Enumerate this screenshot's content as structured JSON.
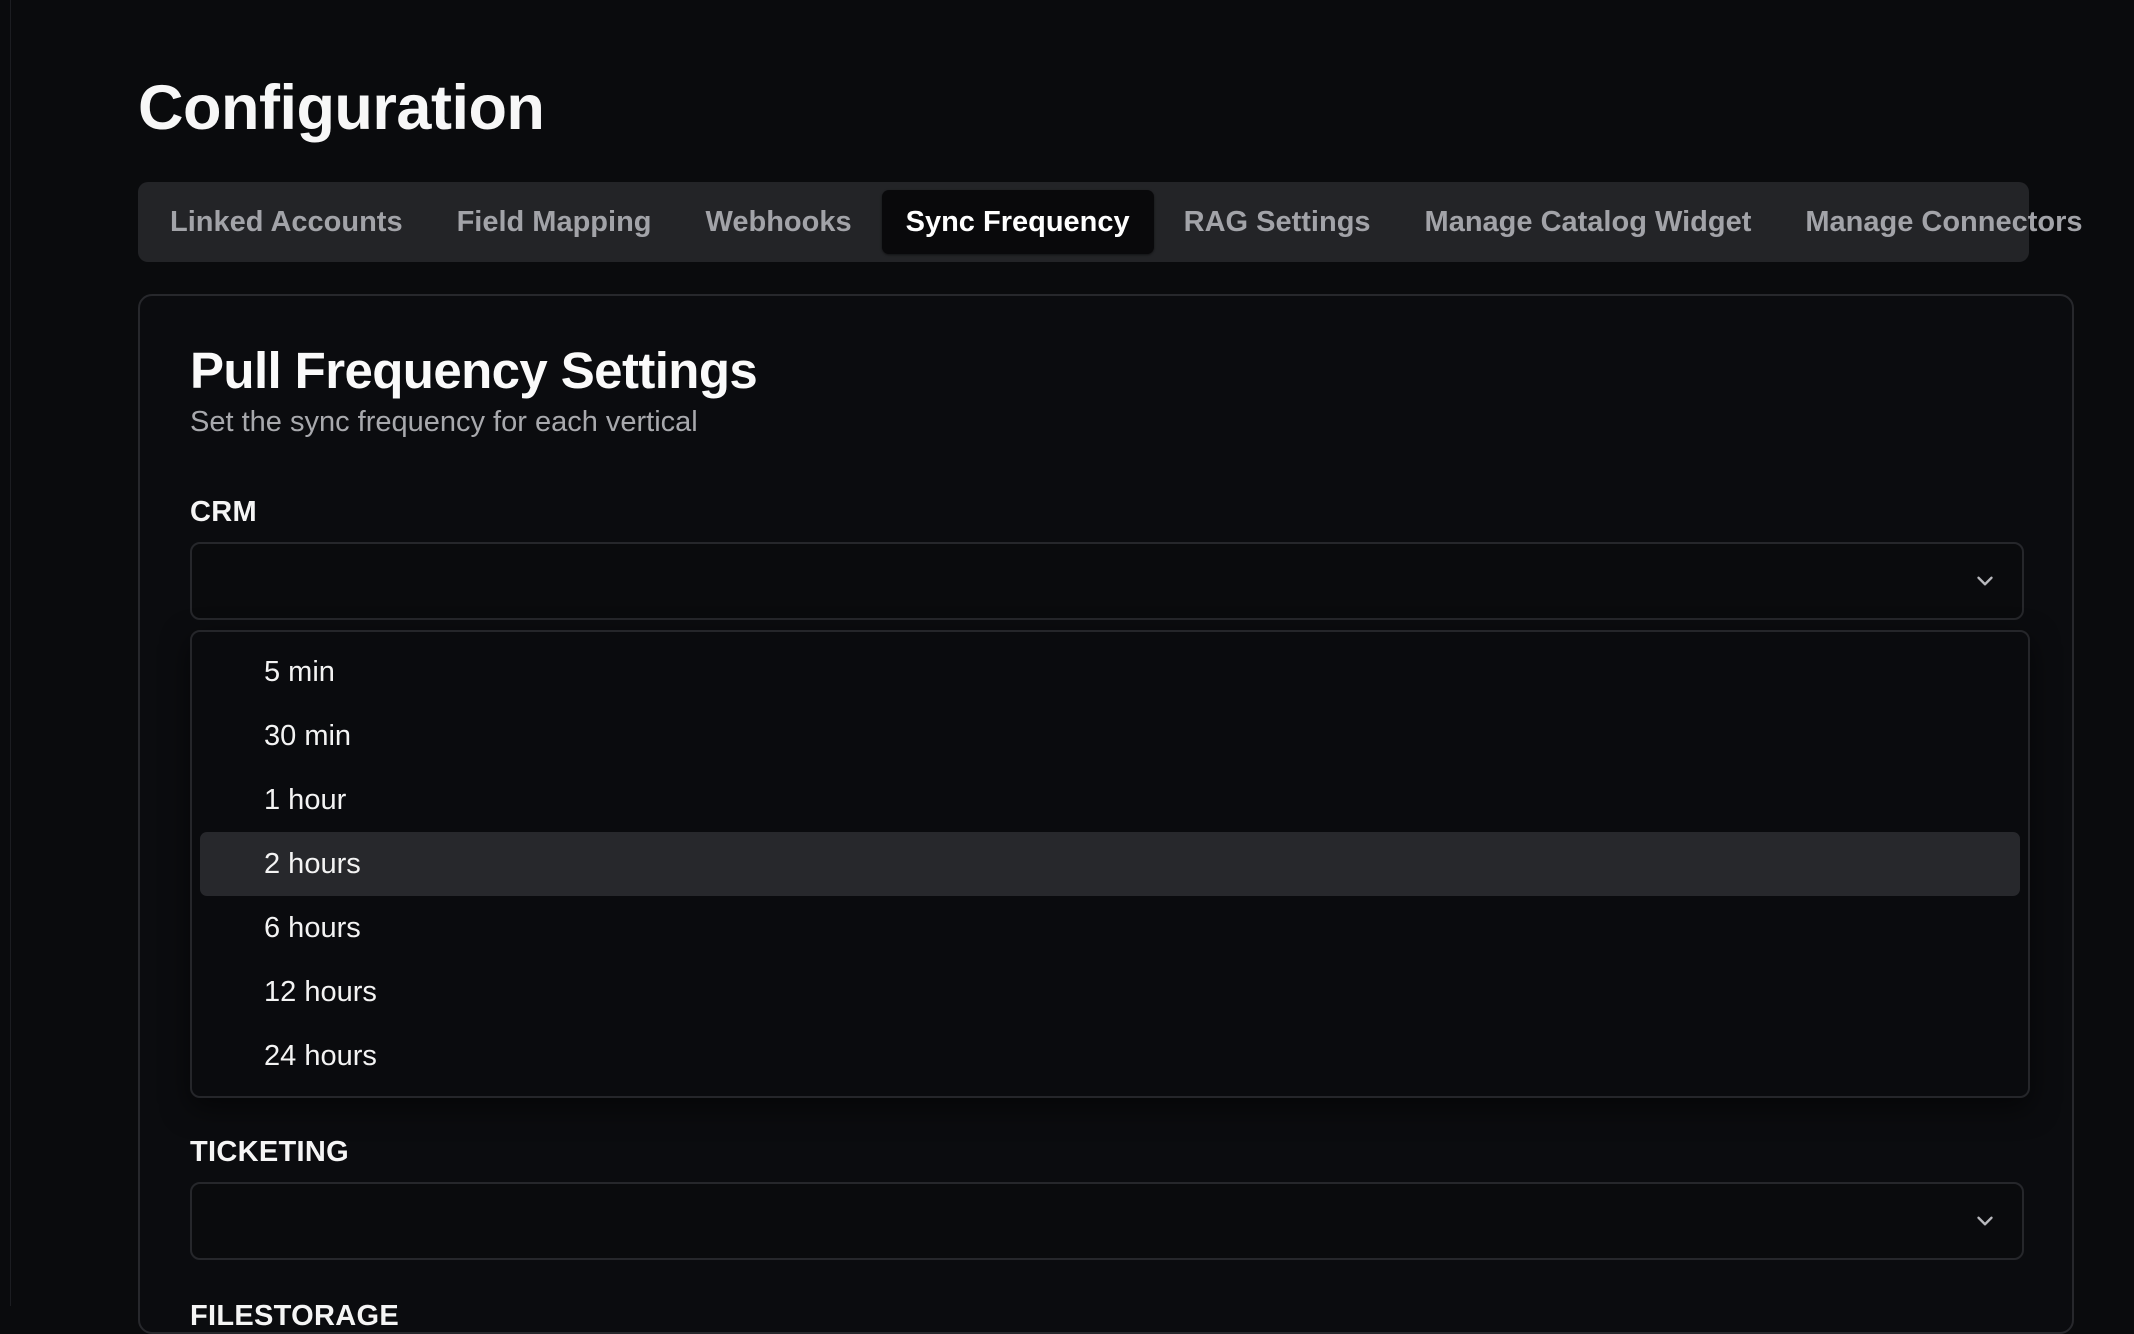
{
  "page": {
    "title": "Configuration"
  },
  "tabs": [
    {
      "label": "Linked Accounts",
      "active": false
    },
    {
      "label": "Field Mapping",
      "active": false
    },
    {
      "label": "Webhooks",
      "active": false
    },
    {
      "label": "Sync Frequency",
      "active": true
    },
    {
      "label": "RAG Settings",
      "active": false
    },
    {
      "label": "Manage Catalog Widget",
      "active": false
    },
    {
      "label": "Manage Connectors",
      "active": false
    }
  ],
  "card": {
    "title": "Pull Frequency Settings",
    "subtitle": "Set the sync frequency for each vertical"
  },
  "verticals": {
    "crm": {
      "label": "CRM",
      "selected_value": "",
      "dropdown_open": true,
      "highlighted_option": "2 hours",
      "chevron_icon": "chevron-down-icon"
    },
    "ticketing": {
      "label": "TICKETING",
      "selected_value": "",
      "dropdown_open": false,
      "chevron_icon": "chevron-down-icon"
    },
    "filestorage": {
      "label": "FILESTORAGE"
    }
  },
  "options": [
    {
      "label": "5 min"
    },
    {
      "label": "30 min"
    },
    {
      "label": "1 hour"
    },
    {
      "label": "2 hours",
      "highlighted": true
    },
    {
      "label": "6 hours"
    },
    {
      "label": "12 hours"
    },
    {
      "label": "24 hours"
    }
  ],
  "colors": {
    "background": "#0a0b0d",
    "tab_bar": "#232427",
    "active_tab": "#09090b",
    "muted_text": "#a2a3a8",
    "border": "#27282c",
    "highlight": "#27282c"
  }
}
